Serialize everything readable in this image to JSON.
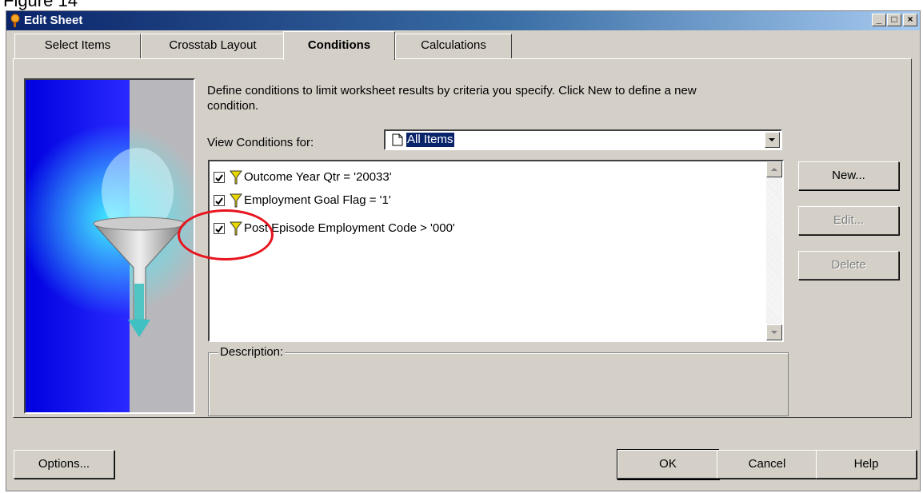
{
  "figure_label": "Figure 14",
  "window": {
    "title": "Edit Sheet",
    "minimize": "_",
    "maximize": "□",
    "close": "×"
  },
  "tabs": [
    {
      "label": "Select Items",
      "active": false
    },
    {
      "label": "Crosstab Layout",
      "active": false
    },
    {
      "label": "Conditions",
      "active": true
    },
    {
      "label": "Calculations",
      "active": false
    }
  ],
  "description": "Define conditions to limit worksheet results by criteria you specify. Click New to define a new condition.",
  "view_conditions": {
    "label": "View Conditions for:",
    "selected": "All Items"
  },
  "conditions": [
    {
      "text": "Outcome Year Qtr = '20033'",
      "checked": true
    },
    {
      "text": "Employment Goal Flag = '1'",
      "checked": true
    },
    {
      "text": "Post Episode Employment Code > '000'",
      "checked": true
    }
  ],
  "description_box": {
    "label": "Description:"
  },
  "side_buttons": {
    "new": "New...",
    "edit": "Edit...",
    "delete": "Delete"
  },
  "bottom_buttons": {
    "options": "Options...",
    "ok": "OK",
    "cancel": "Cancel",
    "help": "Help"
  },
  "colors": {
    "title_start": "#0a246a",
    "title_end": "#a6caf0",
    "annotation_circle": "#e8141e"
  }
}
